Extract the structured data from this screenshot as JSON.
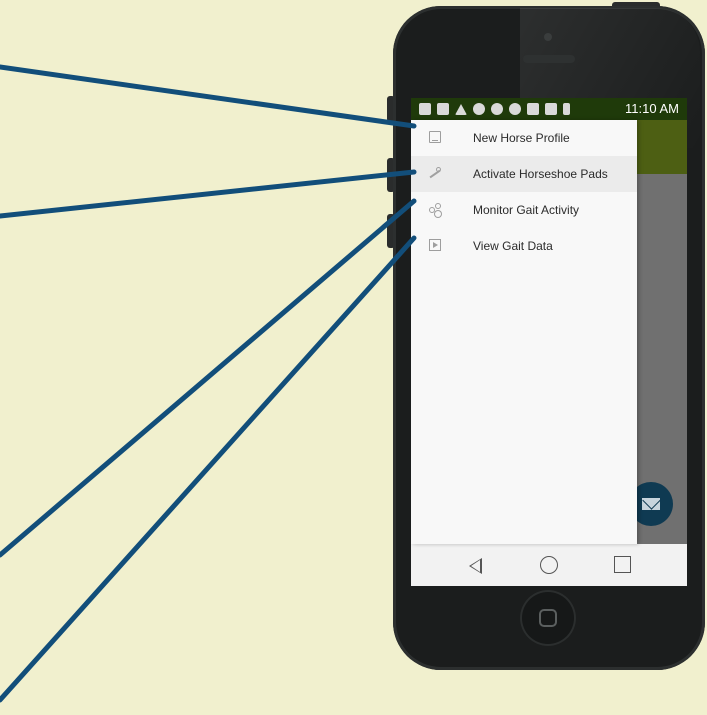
{
  "status_bar": {
    "time": "11:10 AM"
  },
  "drawer": {
    "items": [
      {
        "label": "New Horse Profile",
        "icon": "image-icon"
      },
      {
        "label": "Activate Horseshoe Pads",
        "icon": "wrench-icon"
      },
      {
        "label": "Monitor Gait Activity",
        "icon": "share-icon"
      },
      {
        "label": "View Gait Data",
        "icon": "slideshow-icon"
      }
    ]
  },
  "fab": {
    "icon": "mail-icon"
  },
  "nav_bar": {
    "buttons": [
      "back-icon",
      "home-icon",
      "recents-icon"
    ]
  },
  "colors": {
    "background": "#f1f0ce",
    "callout_lines": "#124e7a",
    "toolbar": "#4d5f13",
    "status_bar": "#1f3a0a",
    "fab": "#0f3a52"
  }
}
